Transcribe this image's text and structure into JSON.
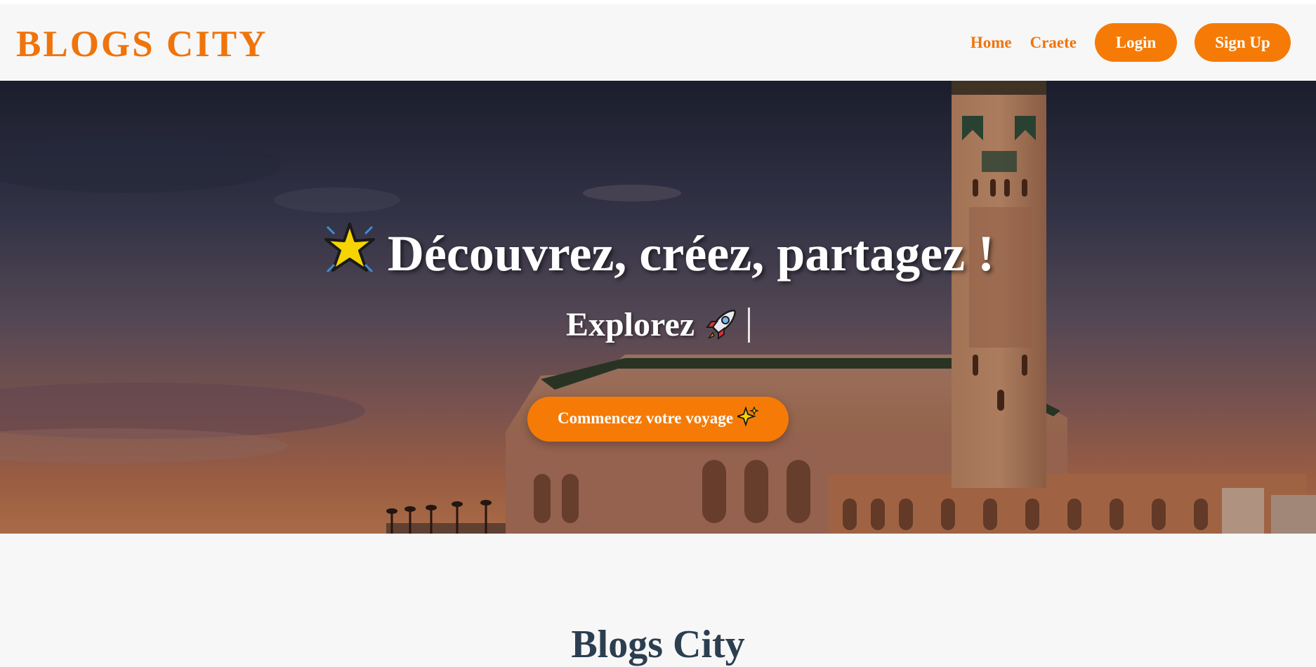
{
  "nav": {
    "brand": "BLOGS CITY",
    "links": [
      "Home",
      "Craete"
    ],
    "login_label": "Login",
    "signup_label": "Sign Up"
  },
  "hero": {
    "title": "Découvrez, créez, partagez !",
    "subtitle": "Explorez",
    "cta_label": "Commencez votre voyage"
  },
  "section": {
    "title": "Blogs City"
  },
  "colors": {
    "accent": "#f57b06",
    "brand_text": "#f0740c",
    "section_title": "#2c3e50",
    "nav_background": "#f7f7f7"
  },
  "icons": [
    "sparkle-star-icon",
    "rocket-icon",
    "sparkles-icon"
  ]
}
